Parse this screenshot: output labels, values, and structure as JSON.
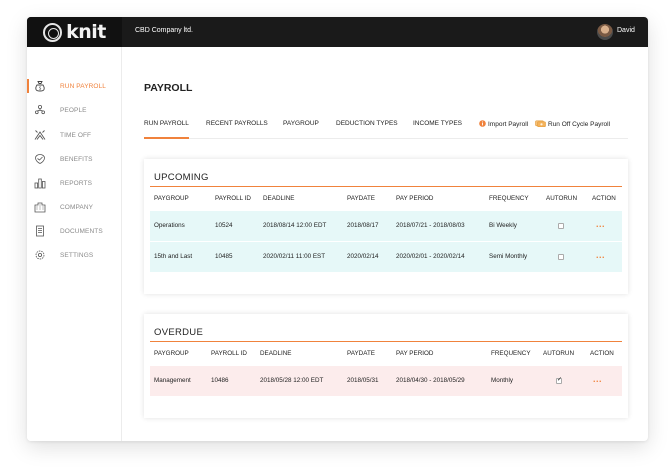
{
  "brand": {
    "logo": "knit",
    "accent": "#f0823c"
  },
  "header": {
    "company": "CBD Company ltd.",
    "user": "David"
  },
  "sidebar": {
    "items": [
      {
        "label": "RUN PAYROLL",
        "icon": "money-bag-icon",
        "active": true
      },
      {
        "label": "PEOPLE",
        "icon": "people-icon"
      },
      {
        "label": "TIME OFF",
        "icon": "time-off-icon"
      },
      {
        "label": "BENEFITS",
        "icon": "benefits-icon"
      },
      {
        "label": "REPORTS",
        "icon": "reports-icon"
      },
      {
        "label": "COMPANY",
        "icon": "company-icon"
      },
      {
        "label": "DOCUMENTS",
        "icon": "documents-icon"
      },
      {
        "label": "SETTINGS",
        "icon": "settings-icon"
      }
    ]
  },
  "page": {
    "title": "PAYROLL"
  },
  "tabs": [
    {
      "label": "RUN PAYROLL",
      "active": true
    },
    {
      "label": "RECENT PAYROLLS"
    },
    {
      "label": "PAYGROUP"
    },
    {
      "label": "DEDUCTION TYPES"
    },
    {
      "label": "INCOME TYPES"
    },
    {
      "label": "Import Payroll",
      "icon": "info-circle-icon"
    },
    {
      "label": "Run Off Cycle Payroll",
      "icon": "cash-icon"
    }
  ],
  "upcoming": {
    "title": "UPCOMING",
    "columns": [
      "PAYGROUP",
      "PAYROLL ID",
      "DEADLINE",
      "PAYDATE",
      "PAY PERIOD",
      "FREQUENCY",
      "AUTORUN",
      "ACTION"
    ],
    "rows": [
      {
        "paygroup": "Operations",
        "payroll_id": "10524",
        "deadline": "2018/08/14 12:00 EDT",
        "paydate": "2018/08/17",
        "pay_period": "2018/07/21 - 2018/08/03",
        "frequency": "Bi Weekly",
        "autorun": false,
        "action": "..."
      },
      {
        "paygroup": "15th and Last",
        "payroll_id": "10485",
        "deadline": "2020/02/11 11:00 EST",
        "paydate": "2020/02/14",
        "pay_period": "2020/02/01 - 2020/02/14",
        "frequency": "Semi Monthly",
        "autorun": false,
        "action": "..."
      }
    ]
  },
  "overdue": {
    "title": "OVERDUE",
    "columns": [
      "PAYGROUP",
      "PAYROLL ID",
      "DEADLINE",
      "PAYDATE",
      "PAY PERIOD",
      "FREQUENCY",
      "AUTORUN",
      "ACTION"
    ],
    "rows": [
      {
        "paygroup": "Management",
        "payroll_id": "10486",
        "deadline": "2018/05/28 12:00 EDT",
        "paydate": "2018/05/31",
        "pay_period": "2018/04/30 - 2018/05/29",
        "frequency": "Monthly",
        "autorun": true,
        "action": "..."
      }
    ]
  }
}
